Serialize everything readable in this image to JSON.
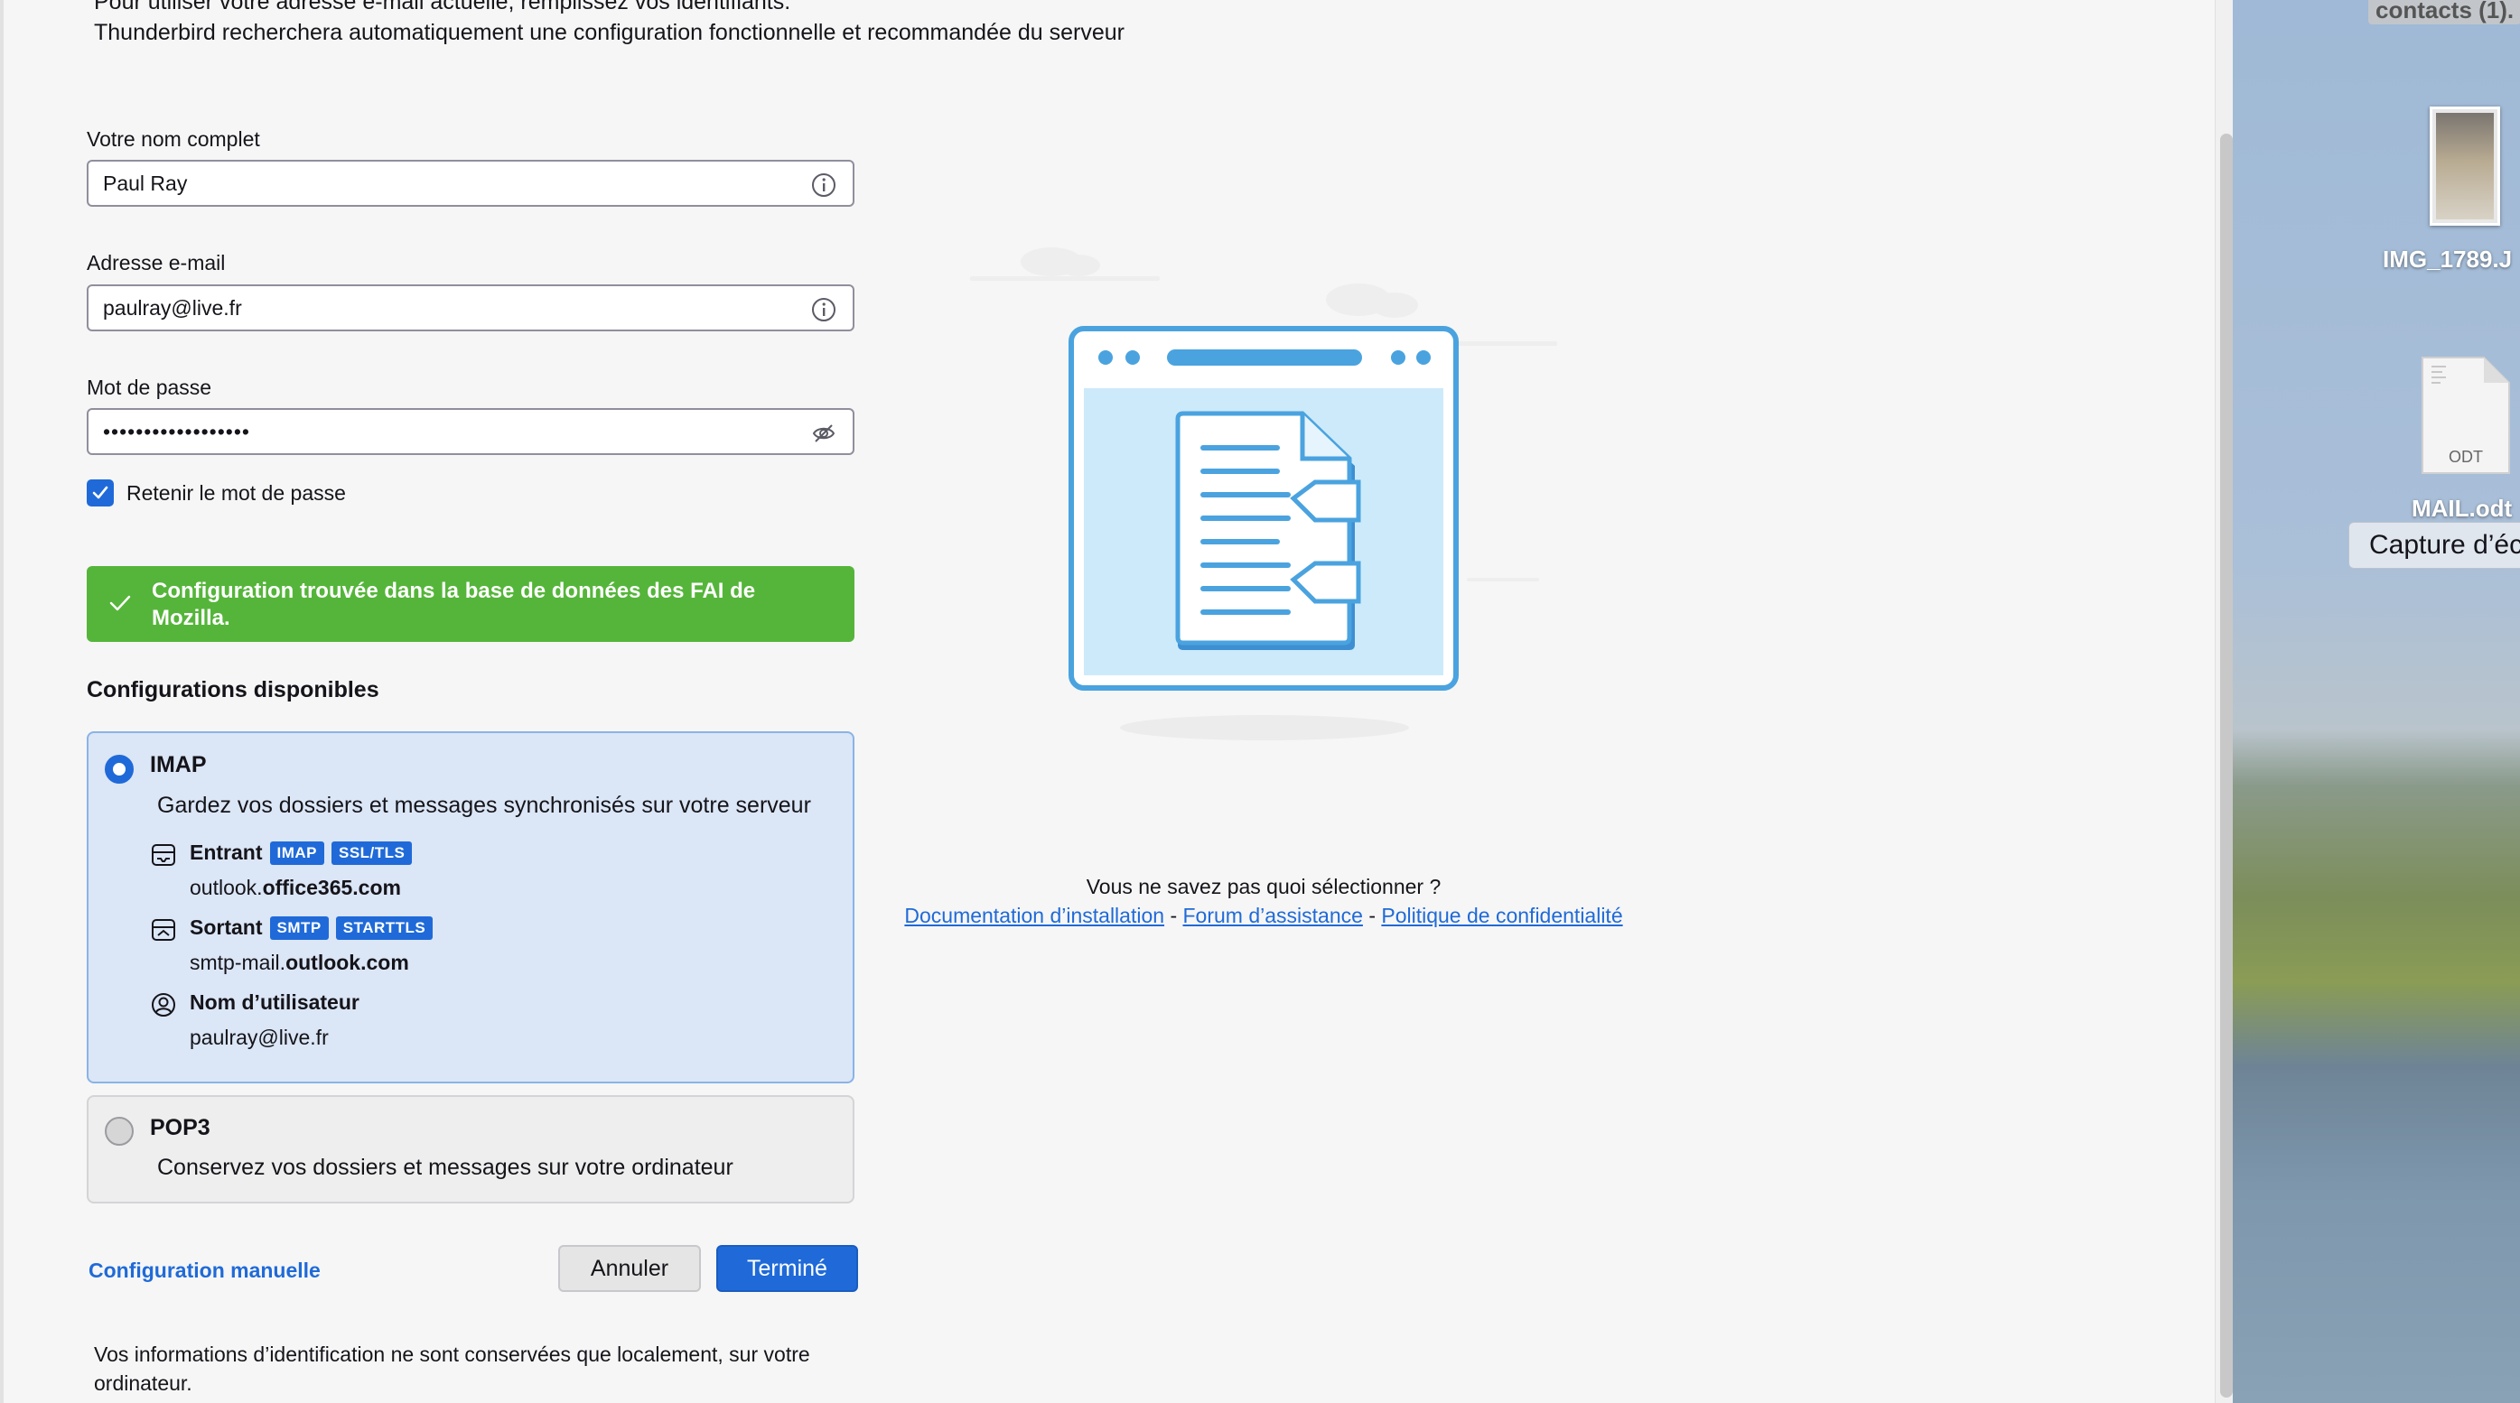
{
  "intro": {
    "line1": "Pour utiliser votre adresse e-mail actuelle, remplissez vos identifiants.",
    "line2": "Thunderbird recherchera automatiquement une configuration fonctionnelle et recommandée du serveur"
  },
  "form": {
    "name_label": "Votre nom complet",
    "name_value": "Paul Ray",
    "email_label": "Adresse e-mail",
    "email_value": "paulray@live.fr",
    "password_label": "Mot de passe",
    "password_value": "••••••••••••••••••",
    "remember_label": "Retenir le mot de passe",
    "remember_checked": true
  },
  "notice": {
    "text": "Configuration trouvée dans la base de données des FAI de Mozilla.",
    "color": "#55b53a"
  },
  "configs": {
    "title": "Configurations disponibles",
    "imap": {
      "name": "IMAP",
      "description": "Gardez vos dossiers et messages synchronisés sur votre serveur",
      "selected": true,
      "incoming_label": "Entrant",
      "incoming_tags": [
        "IMAP",
        "SSL/TLS"
      ],
      "incoming_host_prefix": "outlook.",
      "incoming_host_domain": "office365.com",
      "outgoing_label": "Sortant",
      "outgoing_tags": [
        "SMTP",
        "STARTTLS"
      ],
      "outgoing_host_prefix": "smtp-mail.",
      "outgoing_host_domain": "outlook.com",
      "username_label": "Nom d’utilisateur",
      "username_value": "paulray@live.fr"
    },
    "pop3": {
      "name": "POP3",
      "description": "Conservez vos dossiers et messages sur votre ordinateur",
      "selected": false
    }
  },
  "actions": {
    "manual_config": "Configuration manuelle",
    "cancel": "Annuler",
    "done": "Terminé",
    "accent_color": "#1f6ad8"
  },
  "footnote": "Vos informations d’identification ne sont conservées que localement, sur votre ordinateur.",
  "help": {
    "question": "Vous ne savez pas quoi sélectionner ?",
    "link_docs": "Documentation d’installation",
    "link_forum": "Forum d’assistance",
    "link_privacy": "Politique de confidentialité",
    "separator": "-"
  },
  "desktop": {
    "top_label": "contacts (1).",
    "image_file": "IMG_1789.J",
    "doc_badge": "ODT",
    "doc_file": "MAIL.odt",
    "tooltip": "Capture d’éc"
  }
}
